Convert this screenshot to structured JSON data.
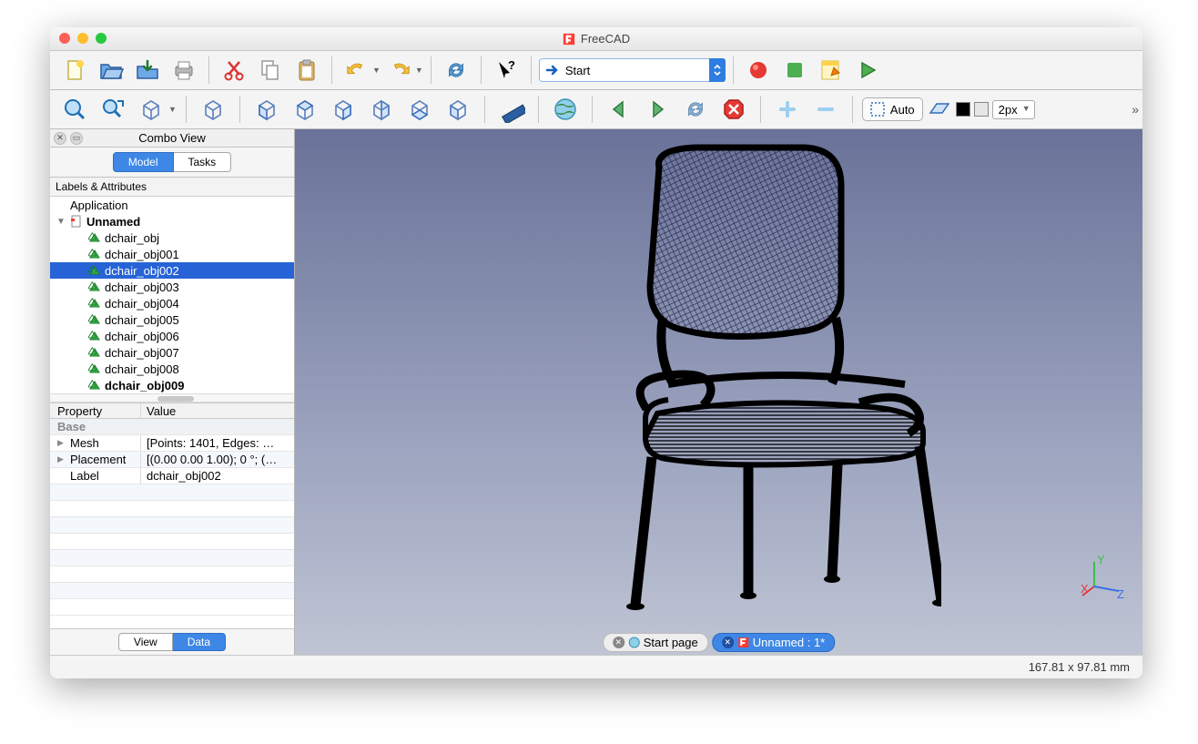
{
  "app": {
    "title": "FreeCAD"
  },
  "workbench": {
    "label": "Start"
  },
  "linewidth": "2px",
  "draw_auto": "Auto",
  "combo": {
    "title": "Combo View",
    "tabs": {
      "model": "Model",
      "tasks": "Tasks"
    },
    "tree_header": "Labels & Attributes",
    "root": "Application",
    "doc": "Unnamed",
    "items": [
      "dchair_obj",
      "dchair_obj001",
      "dchair_obj002",
      "dchair_obj003",
      "dchair_obj004",
      "dchair_obj005",
      "dchair_obj006",
      "dchair_obj007",
      "dchair_obj008",
      "dchair_obj009"
    ],
    "selected_index": 2,
    "bold_index": 9
  },
  "properties": {
    "headers": {
      "prop": "Property",
      "val": "Value"
    },
    "group": "Base",
    "rows": [
      {
        "name": "Mesh",
        "value": "[Points: 1401, Edges: …"
      },
      {
        "name": "Placement",
        "value": "[(0.00 0.00 1.00); 0 °; (…"
      },
      {
        "name": "Label",
        "value": "dchair_obj002"
      }
    ],
    "bottom_tabs": {
      "view": "View",
      "data": "Data"
    }
  },
  "doctabs": {
    "start": "Start page",
    "active": "Unnamed : 1*"
  },
  "status": "167.81 x 97.81  mm"
}
